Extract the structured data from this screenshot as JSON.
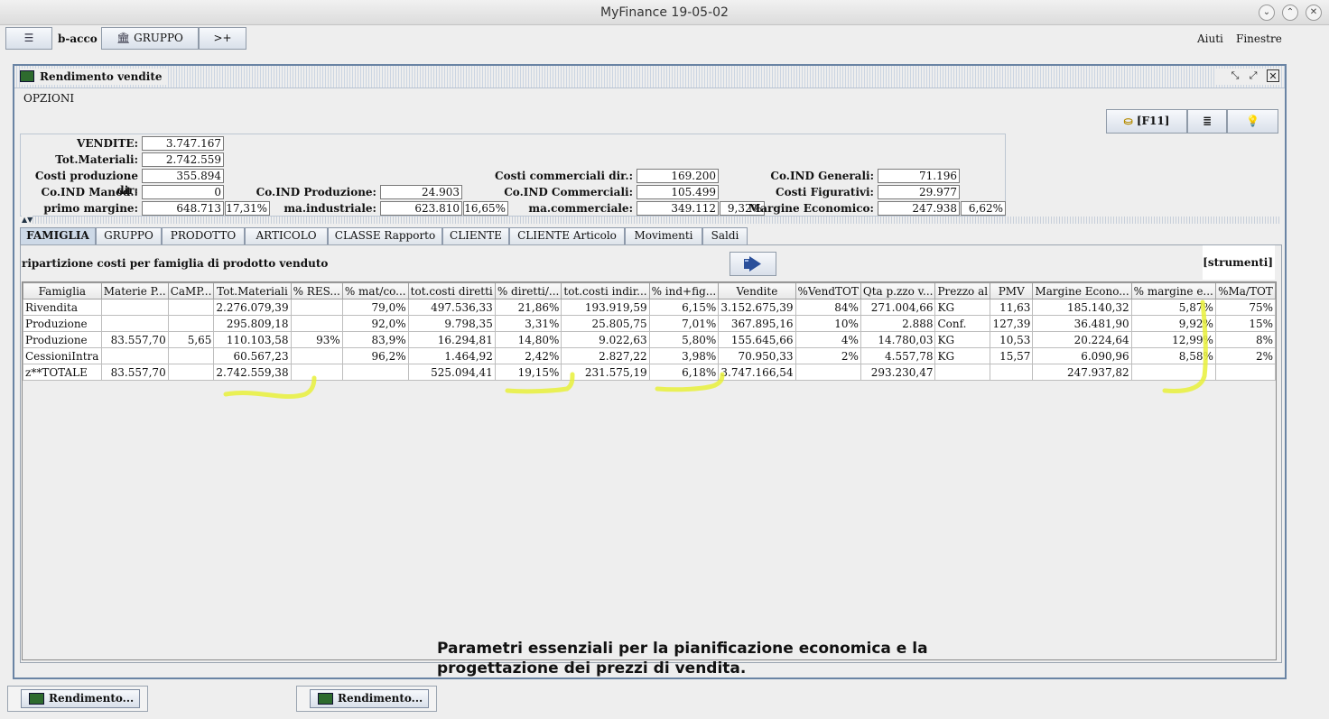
{
  "window": {
    "title": "MyFinance 19-05-02"
  },
  "menubar": {
    "list_label": "☰",
    "b_acco": "b-acco",
    "gruppo": "GRUPPO",
    "arrow": ">+",
    "aiuti": "Aiuti",
    "finestre": "Finestre"
  },
  "frame": {
    "title": "Rendimento vendite",
    "opzioni": "OPZIONI",
    "tool_f11": "[F11]"
  },
  "summary": {
    "vendite": {
      "label": "VENDITE:",
      "value": "3.747.167"
    },
    "tot_materiali": {
      "label": "Tot.Materiali:",
      "value": "2.742.559"
    },
    "costi_produzione": {
      "label": "Costi produzione dir:",
      "value": "355.894"
    },
    "coind_manod": {
      "label": "Co.IND Manod.:",
      "value": "0"
    },
    "primo_margine": {
      "label": "primo margine:",
      "value": "648.713",
      "pct": "17,31%"
    },
    "coind_produzione": {
      "label": "Co.IND Produzione:",
      "value": "24.903"
    },
    "ma_industriale": {
      "label": "ma.industriale:",
      "value": "623.810",
      "pct": "16,65%"
    },
    "costi_commerciali": {
      "label": "Costi commerciali dir.:",
      "value": "169.200"
    },
    "coind_commerciali": {
      "label": "Co.IND Commerciali:",
      "value": "105.499"
    },
    "ma_commerciale": {
      "label": "ma.commerciale:",
      "value": "349.112",
      "pct": "9,32%"
    },
    "coind_generali": {
      "label": "Co.IND Generali:",
      "value": "71.196"
    },
    "costi_figurativi": {
      "label": "Costi Figurativi:",
      "value": "29.977"
    },
    "margine_economico": {
      "label": "Margine Economico:",
      "value": "247.938",
      "pct": "6,62%"
    }
  },
  "tabs": [
    "FAMIGLIA",
    "GRUPPO",
    "PRODOTTO",
    "ARTICOLO",
    "CLASSE Rapporto",
    "CLIENTE",
    "CLIENTE Articolo",
    "Movimenti",
    "Saldi"
  ],
  "panel": {
    "title": "ripartizione costi per famiglia di prodotto venduto",
    "strumenti": "[strumenti]"
  },
  "table": {
    "headers": [
      "Famiglia",
      "Materie P...",
      "CaMP...",
      "Tot.Materiali",
      "% RES...",
      "% mat/co...",
      "tot.costi diretti",
      "% diretti/...",
      "tot.costi indir...",
      "% ind+fig...",
      "Vendite",
      "%VendTOT",
      "Qta p.zzo v...",
      "Prezzo al",
      "PMV",
      "Margine Econo...",
      "% margine e...",
      "%Ma/TOT"
    ],
    "rows": [
      [
        "Rivendita",
        "",
        "",
        "2.276.079,39",
        "",
        "79,0%",
        "497.536,33",
        "21,86%",
        "193.919,59",
        "6,15%",
        "3.152.675,39",
        "84%",
        "271.004,66",
        "KG",
        "11,63",
        "185.140,32",
        "5,87%",
        "75%"
      ],
      [
        "Produzione",
        "",
        "",
        "295.809,18",
        "",
        "92,0%",
        "9.798,35",
        "3,31%",
        "25.805,75",
        "7,01%",
        "367.895,16",
        "10%",
        "2.888",
        "Conf.",
        "127,39",
        "36.481,90",
        "9,92%",
        "15%"
      ],
      [
        "Produzione",
        "83.557,70",
        "5,65",
        "110.103,58",
        "93%",
        "83,9%",
        "16.294,81",
        "14,80%",
        "9.022,63",
        "5,80%",
        "155.645,66",
        "4%",
        "14.780,03",
        "KG",
        "10,53",
        "20.224,64",
        "12,99%",
        "8%"
      ],
      [
        "CessioniIntra",
        "",
        "",
        "60.567,23",
        "",
        "96,2%",
        "1.464,92",
        "2,42%",
        "2.827,22",
        "3,98%",
        "70.950,33",
        "2%",
        "4.557,78",
        "KG",
        "15,57",
        "6.090,96",
        "8,58%",
        "2%"
      ],
      [
        "z**TOTALE",
        "83.557,70",
        "",
        "2.742.559,38",
        "",
        "",
        "525.094,41",
        "19,15%",
        "231.575,19",
        "6,18%",
        "3.747.166,54",
        "",
        "293.230,47",
        "",
        "",
        "247.937,82",
        "",
        ""
      ]
    ]
  },
  "caption": {
    "line1": "Parametri essenziali per la pianificazione economica e la",
    "line2": "progettazione dei prezzi di vendita."
  },
  "taskbar": [
    "Rendimento...",
    "Rendimento..."
  ]
}
